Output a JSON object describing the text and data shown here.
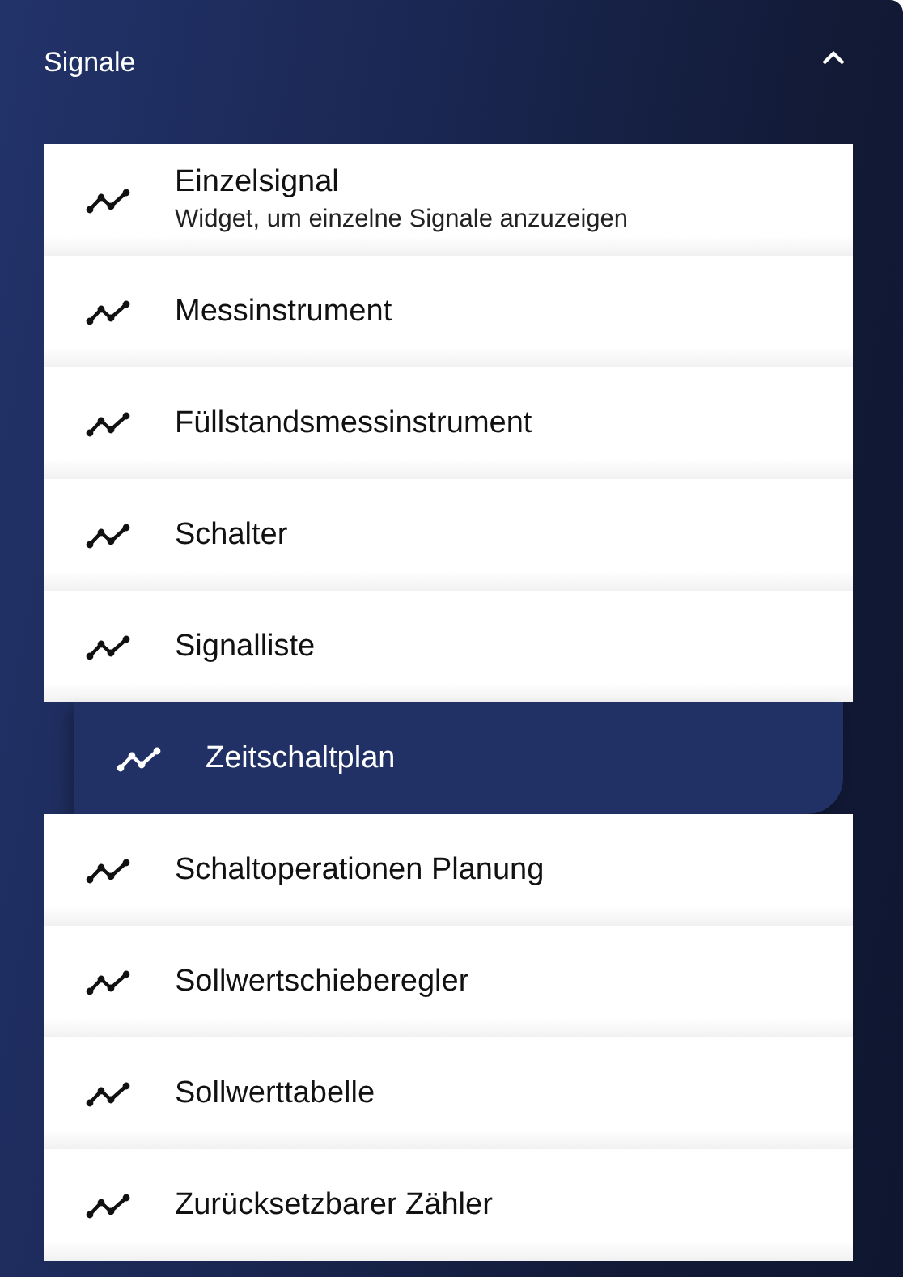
{
  "section": {
    "title": "Signale",
    "expanded": true
  },
  "items": [
    {
      "label": "Einzelsignal",
      "description": "Widget, um einzelne Signale anzuzeigen",
      "selected": false
    },
    {
      "label": "Messinstrument",
      "selected": false
    },
    {
      "label": "Füllstandsmessinstrument",
      "selected": false
    },
    {
      "label": "Schalter",
      "selected": false
    },
    {
      "label": "Signalliste",
      "selected": false
    },
    {
      "label": "Zeitschaltplan",
      "selected": true
    },
    {
      "label": "Schaltoperationen Planung",
      "selected": false
    },
    {
      "label": "Sollwertschieberegler",
      "selected": false
    },
    {
      "label": "Sollwerttabelle",
      "selected": false
    },
    {
      "label": "Zurücksetzbarer Zähler",
      "selected": false
    }
  ]
}
